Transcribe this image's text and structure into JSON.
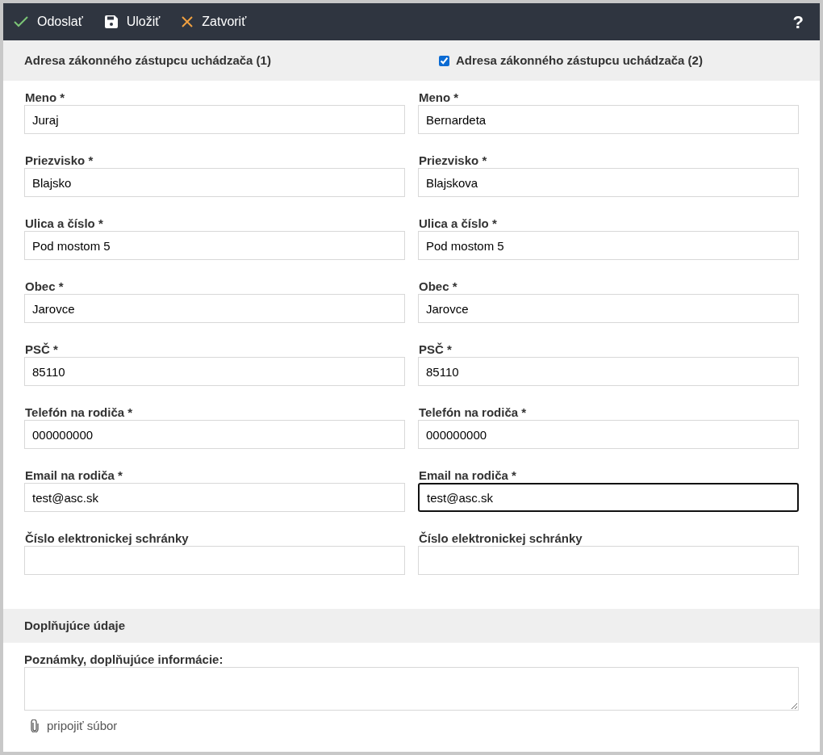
{
  "toolbar": {
    "buttons": [
      {
        "kind": "check",
        "label": "Odoslať"
      },
      {
        "kind": "save",
        "label": "Uložiť"
      },
      {
        "kind": "close",
        "label": "Zatvoriť"
      }
    ],
    "help": "?"
  },
  "columns": [
    {
      "title": "Adresa zákonného zástupcu uchádzača (1)",
      "kind": "plain",
      "fields": [
        {
          "label": "Meno *",
          "value": "Juraj",
          "focused": false
        },
        {
          "label": "Priezvisko *",
          "value": "Blajsko",
          "focused": false
        },
        {
          "label": "Ulica a číslo *",
          "value": "Pod mostom 5",
          "focused": false
        },
        {
          "label": "Obec *",
          "value": "Jarovce",
          "focused": false
        },
        {
          "label": "PSČ *",
          "value": "85110",
          "focused": false
        },
        {
          "label": "Telefón na rodiča *",
          "value": "000000000",
          "focused": false
        },
        {
          "label": "Email na rodiča *",
          "value": "test@asc.sk",
          "focused": false
        },
        {
          "label": "Číslo elektronickej schránky",
          "focused": false
        }
      ]
    },
    {
      "title": "Adresa zákonného zástupcu uchádzača (2)",
      "kind": "checkbox",
      "checked": true,
      "fields": [
        {
          "label": "Meno *",
          "value": "Bernardeta",
          "focused": false
        },
        {
          "label": "Priezvisko *",
          "value": "Blajskova",
          "focused": false
        },
        {
          "label": "Ulica a číslo *",
          "value": "Pod mostom 5",
          "focused": false
        },
        {
          "label": "Obec *",
          "value": "Jarovce",
          "focused": false
        },
        {
          "label": "PSČ *",
          "value": "85110",
          "focused": false
        },
        {
          "label": "Telefón na rodiča *",
          "value": "000000000",
          "focused": false
        },
        {
          "label": "Email na rodiča *",
          "value": "test@asc.sk",
          "focused": true
        },
        {
          "label": "Číslo elektronickej schránky",
          "focused": false
        }
      ]
    }
  ],
  "extra": {
    "title": "Doplňujúce údaje",
    "notes_label": "Poznámky, doplňujúce informácie:",
    "attach": "pripojiť súbor"
  }
}
